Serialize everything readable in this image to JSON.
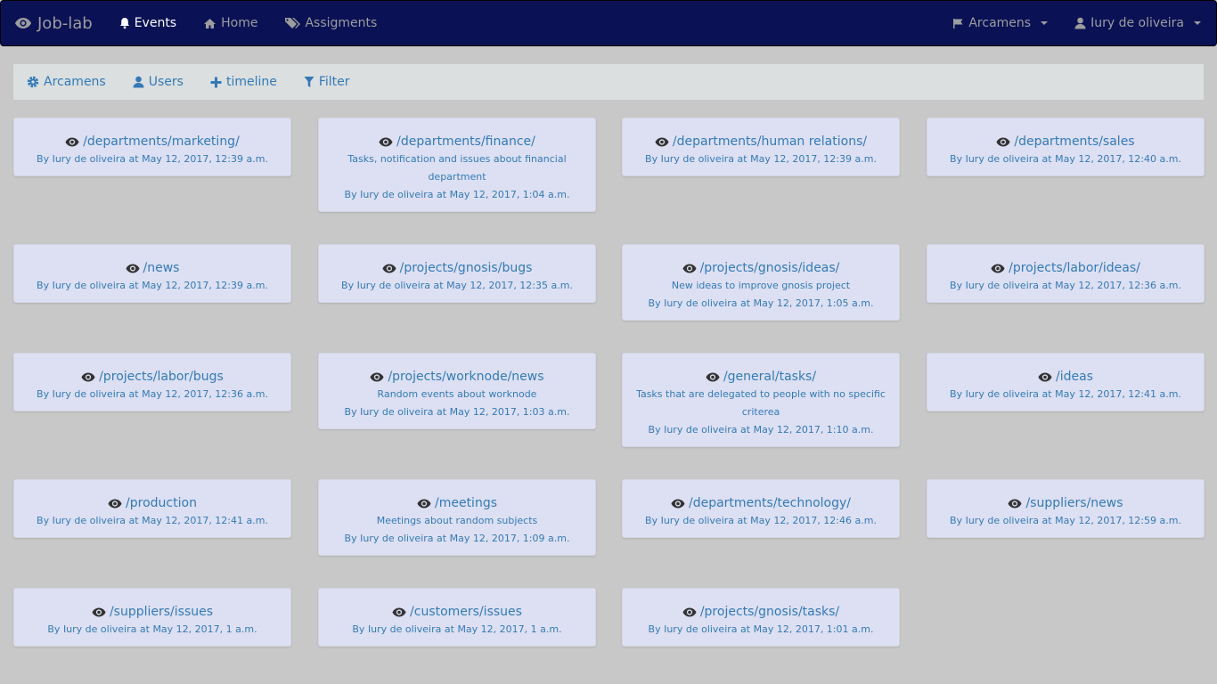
{
  "navbar": {
    "brand": "Job-lab",
    "items": [
      {
        "label": "Events",
        "icon": "bell-icon",
        "active": true
      },
      {
        "label": "Home",
        "icon": "home-icon",
        "active": false
      },
      {
        "label": "Assigments",
        "icon": "tags-icon",
        "active": false
      }
    ],
    "org_menu": "Arcamens",
    "user_menu": "Iury de oliveira"
  },
  "toolbar": {
    "arcamens": "Arcamens",
    "users": "Users",
    "timeline": "timeline",
    "filter": "Filter"
  },
  "cards": [
    {
      "title": "/departments/marketing/",
      "desc": "",
      "author": "Iury de oliveira",
      "date": "May 12, 2017, 12:39 a.m."
    },
    {
      "title": "/departments/finance/",
      "desc": "Tasks, notification and issues about financial department",
      "author": "Iury de oliveira",
      "date": "May 12, 2017, 1:04 a.m."
    },
    {
      "title": "/departments/human relations/",
      "desc": "",
      "author": "Iury de oliveira",
      "date": "May 12, 2017, 12:39 a.m."
    },
    {
      "title": "/departments/sales",
      "desc": "",
      "author": "Iury de oliveira",
      "date": "May 12, 2017, 12:40 a.m."
    },
    {
      "title": "/news",
      "desc": "",
      "author": "Iury de oliveira",
      "date": "May 12, 2017, 12:39 a.m."
    },
    {
      "title": "/projects/gnosis/bugs",
      "desc": "",
      "author": "Iury de oliveira",
      "date": "May 12, 2017, 12:35 a.m."
    },
    {
      "title": "/projects/gnosis/ideas/",
      "desc": "New ideas to improve gnosis project",
      "author": "Iury de oliveira",
      "date": "May 12, 2017, 1:05 a.m."
    },
    {
      "title": "/projects/labor/ideas/",
      "desc": "",
      "author": "Iury de oliveira",
      "date": "May 12, 2017, 12:36 a.m."
    },
    {
      "title": "/projects/labor/bugs",
      "desc": "",
      "author": "Iury de oliveira",
      "date": "May 12, 2017, 12:36 a.m."
    },
    {
      "title": "/projects/worknode/news",
      "desc": "Random events about worknode",
      "author": "Iury de oliveira",
      "date": "May 12, 2017, 1:03 a.m."
    },
    {
      "title": "/general/tasks/",
      "desc": "Tasks that are delegated to people with no specific criterea",
      "author": "Iury de oliveira",
      "date": "May 12, 2017, 1:10 a.m."
    },
    {
      "title": "/ideas",
      "desc": "",
      "author": "Iury de oliveira",
      "date": "May 12, 2017, 12:41 a.m."
    },
    {
      "title": "/production",
      "desc": "",
      "author": "Iury de oliveira",
      "date": "May 12, 2017, 12:41 a.m."
    },
    {
      "title": "/meetings",
      "desc": "Meetings about random subjects",
      "author": "Iury de oliveira",
      "date": "May 12, 2017, 1:09 a.m."
    },
    {
      "title": "/departments/technology/",
      "desc": "",
      "author": "Iury de oliveira",
      "date": "May 12, 2017, 12:46 a.m."
    },
    {
      "title": "/suppliers/news",
      "desc": "",
      "author": "Iury de oliveira",
      "date": "May 12, 2017, 12:59 a.m."
    },
    {
      "title": "/suppliers/issues",
      "desc": "",
      "author": "Iury de oliveira",
      "date": "May 12, 2017, 1 a.m."
    },
    {
      "title": "/customers/issues",
      "desc": "",
      "author": "Iury de oliveira",
      "date": "May 12, 2017, 1 a.m."
    },
    {
      "title": "/projects/gnosis/tasks/",
      "desc": "",
      "author": "Iury de oliveira",
      "date": "May 12, 2017, 1:01 a.m."
    }
  ],
  "labels": {
    "by": "By",
    "at": "at"
  },
  "colors": {
    "navbar": "#0a1155",
    "link": "#337ab7",
    "card": "#dde0f2",
    "background": "#c8c8c8"
  }
}
